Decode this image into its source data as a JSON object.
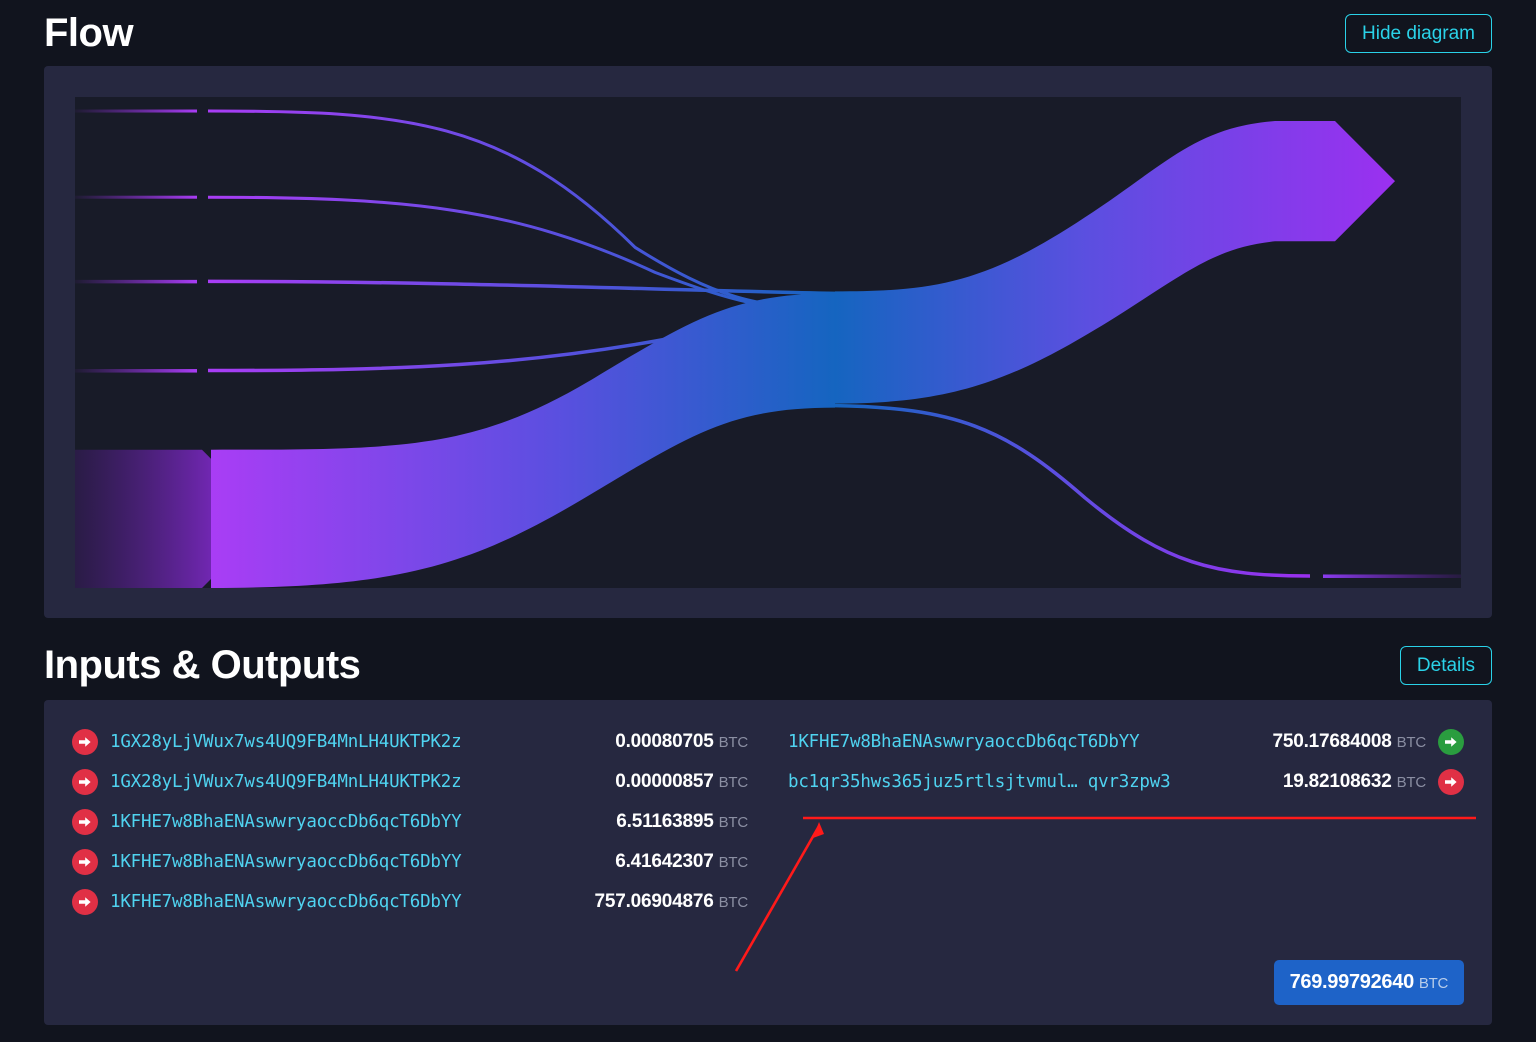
{
  "flow": {
    "title": "Flow",
    "hide_button": "Hide diagram",
    "diagram": {
      "type": "sankey",
      "description": "Bitcoin transaction flow sankey diagram",
      "colors": {
        "input_purple": "#9b30f0",
        "waist_blue": "#1565c0",
        "output_violet": "#8b3cf0",
        "plot_bg": "#181b28",
        "card_bg": "#262840"
      },
      "inputs": [
        {
          "label": "0.00080705",
          "weight": 0.00080705,
          "thin": true
        },
        {
          "label": "0.00000857",
          "weight": 8.57e-06,
          "thin": true
        },
        {
          "label": "6.51163895",
          "weight": 6.51163895,
          "thin": true
        },
        {
          "label": "6.41642307",
          "weight": 6.41642307,
          "thin": true
        },
        {
          "label": "757.06904876",
          "weight": 757.06904876,
          "thin": false
        }
      ],
      "outputs": [
        {
          "label": "750.17684008",
          "weight": 750.17684008,
          "thin": false
        },
        {
          "label": "19.82108632",
          "weight": 19.82108632,
          "thin": true
        }
      ]
    }
  },
  "io": {
    "title": "Inputs & Outputs",
    "details_button": "Details",
    "unit": "BTC",
    "inputs": [
      {
        "icon": "arrow-right-red",
        "address": "1GX28yLjVWux7ws4UQ9FB4MnLH4UKTPK2z",
        "amount": "0.00080705"
      },
      {
        "icon": "arrow-right-red",
        "address": "1GX28yLjVWux7ws4UQ9FB4MnLH4UKTPK2z",
        "amount": "0.00000857"
      },
      {
        "icon": "arrow-right-red",
        "address": "1KFHE7w8BhaENAswwryaoccDb6qcT6DbYY",
        "amount": "6.51163895"
      },
      {
        "icon": "arrow-right-red",
        "address": "1KFHE7w8BhaENAswwryaoccDb6qcT6DbYY",
        "amount": "6.41642307"
      },
      {
        "icon": "arrow-right-red",
        "address": "1KFHE7w8BhaENAswwryaoccDb6qcT6DbYY",
        "amount": "757.06904876"
      }
    ],
    "outputs": [
      {
        "icon": "arrow-right-green",
        "address": "1KFHE7w8BhaENAswwryaoccDb6qcT6DbYY",
        "amount": "750.17684008"
      },
      {
        "icon": "arrow-right-red",
        "address": "bc1qr35hws365juz5rtlsjtvmul… qvr3zpw3",
        "amount": "19.82108632"
      }
    ],
    "total": "769.99792640"
  },
  "annotation": {
    "color": "#ff1a1a",
    "underline_target": "second output row",
    "arrow_points_to": "bc1qr35hws365juz5rtlsjtvmul… qvr3zpw3"
  }
}
